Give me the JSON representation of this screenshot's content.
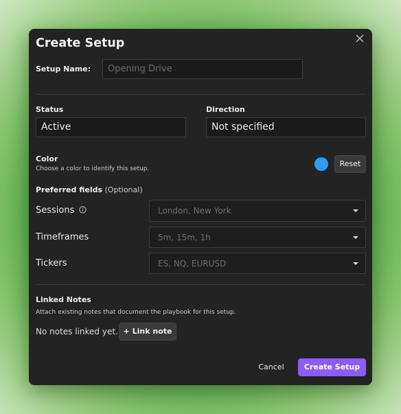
{
  "dialog": {
    "title": "Create Setup",
    "setup_name": {
      "label": "Setup Name:",
      "value": "",
      "placeholder": "Opening Drive"
    },
    "status": {
      "label": "Status",
      "value": "Active"
    },
    "direction": {
      "label": "Direction",
      "value": "Not specified"
    },
    "color": {
      "label": "Color",
      "description": "Choose a color to identify this setup.",
      "swatch": "#2d9bf0",
      "reset_label": "Reset"
    },
    "preferred_fields": {
      "label": "Preferred fields",
      "optional": "(Optional)",
      "fields": [
        {
          "label": "Sessions",
          "placeholder": "London, New York",
          "info_icon": "info-icon"
        },
        {
          "label": "Timeframes",
          "placeholder": "5m, 15m, 1h"
        },
        {
          "label": "Tickers",
          "placeholder": "ES, NQ, EURUSD"
        }
      ]
    },
    "linked_notes": {
      "label": "Linked Notes",
      "description": "Attach existing notes that document the playbook for this setup.",
      "empty_text": "No notes linked yet.",
      "link_button": "+ Link note"
    },
    "footer": {
      "cancel": "Cancel",
      "submit": "Create Setup"
    },
    "colors": {
      "accent": "#8b5cf6",
      "background": "#232323"
    }
  }
}
